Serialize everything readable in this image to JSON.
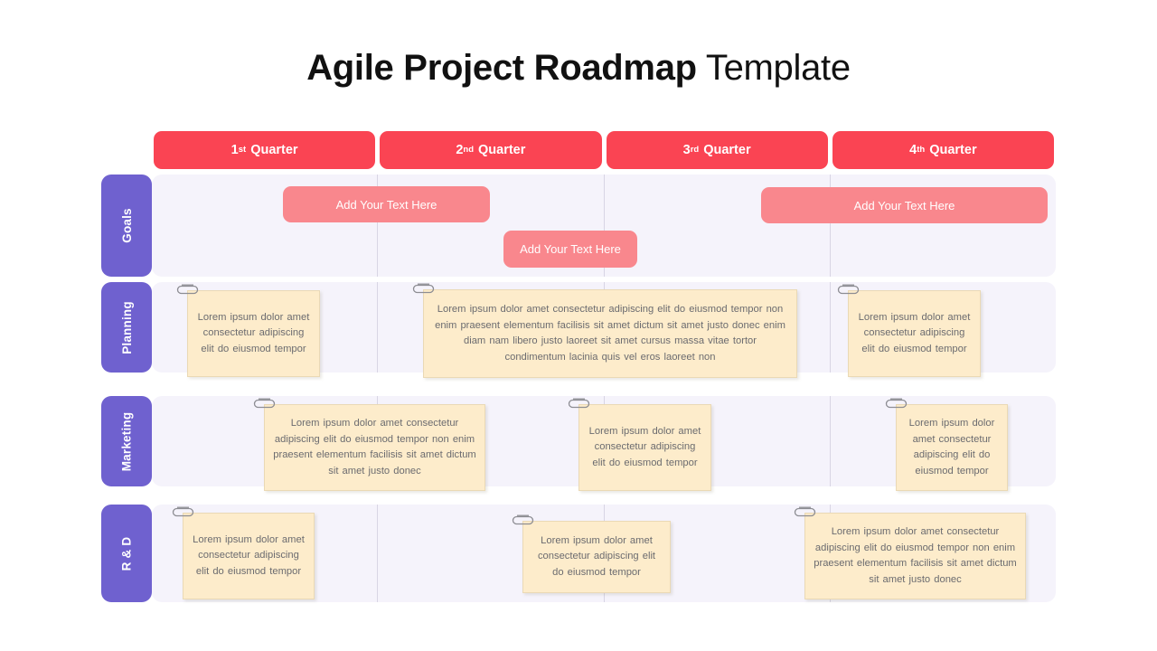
{
  "title": {
    "bold_part": "Agile Project Roadmap",
    "light_part": "Template"
  },
  "colors": {
    "quarter_header": "#fa4453",
    "row_label": "#6f61cf",
    "goal_pill": "#f9878d",
    "row_band": "#f5f3fb",
    "note_bg": "#fdeccb",
    "note_border": "#ead9b5",
    "note_text": "#6b6b6f",
    "title_text": "#111111"
  },
  "quarters": [
    {
      "number": "1",
      "ordinal": "st",
      "word": "Quarter"
    },
    {
      "number": "2",
      "ordinal": "nd",
      "word": "Quarter"
    },
    {
      "number": "3",
      "ordinal": "rd",
      "word": "Quarter"
    },
    {
      "number": "4",
      "ordinal": "th",
      "word": "Quarter"
    }
  ],
  "rows": {
    "goals": {
      "label": "Goals",
      "pills": [
        {
          "text": "Add Your Text Here"
        },
        {
          "text": "Add Your Text Here"
        },
        {
          "text": "Add Your Text Here"
        }
      ]
    },
    "planning": {
      "label": "Planning",
      "notes": [
        {
          "text": "Lorem  ipsum dolor amet consectetur adipiscing elit do eiusmod tempor",
          "icon": "paperclip-icon"
        },
        {
          "text": "Lorem  ipsum dolor  amet consectetur  adipiscing elit do eiusmod tempor non enim praesent elementum  facilisis sit amet dictum sit amet  justo donec enim  diam nam libero justo laoreet sit amet cursus massa vitae tortor condimentum  lacinia quis vel eros laoreet non",
          "icon": "paperclip-icon"
        },
        {
          "text": "Lorem  ipsum dolor amet consectetur adipiscing elit do eiusmod tempor",
          "icon": "paperclip-icon"
        }
      ]
    },
    "marketing": {
      "label": "Marketing",
      "notes": [
        {
          "text": "Lorem  ipsum dolor  amet consectetur adipiscing elit do eiusmod tempor  non enim praesent elementum  facilisis sit amet dictum sit amet  justo donec",
          "icon": "paperclip-icon"
        },
        {
          "text": "Lorem  ipsum dolor amet consectetur adipiscing elit do eiusmod tempor",
          "icon": "paperclip-icon"
        },
        {
          "text": "Lorem  ipsum dolor amet consectetur adipiscing elit do eiusmod tempor",
          "icon": "paperclip-icon"
        }
      ]
    },
    "rd": {
      "label": "R & D",
      "notes": [
        {
          "text": "Lorem  ipsum dolor amet consectetur adipiscing elit do eiusmod tempor",
          "icon": "paperclip-icon"
        },
        {
          "text": "Lorem  ipsum dolor  amet consectetur adipiscing elit do eiusmod tempor",
          "icon": "paperclip-icon"
        },
        {
          "text": "Lorem  ipsum dolor  amet consectetur adipiscing elit do eiusmod tempor  non enim praesent elementum  facilisis sit amet dictum sit amet  justo donec",
          "icon": "paperclip-icon"
        }
      ]
    }
  }
}
